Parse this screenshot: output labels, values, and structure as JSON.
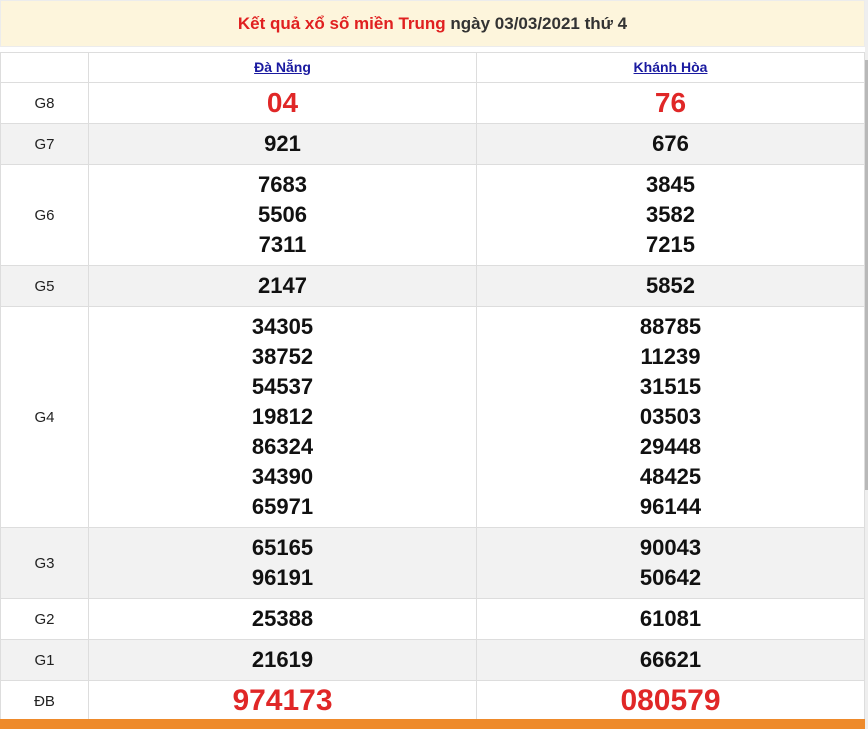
{
  "header": {
    "title_prefix": "Kết quả xổ số miền Trung",
    "title_suffix": " ngày 03/03/2021 thứ 4"
  },
  "provinces": [
    "Đà Nẵng",
    "Khánh Hòa"
  ],
  "prizes": [
    {
      "label": "G8",
      "col1": [
        "04"
      ],
      "col2": [
        "76"
      ]
    },
    {
      "label": "G7",
      "col1": [
        "921"
      ],
      "col2": [
        "676"
      ]
    },
    {
      "label": "G6",
      "col1": [
        "7683",
        "5506",
        "7311"
      ],
      "col2": [
        "3845",
        "3582",
        "7215"
      ]
    },
    {
      "label": "G5",
      "col1": [
        "2147"
      ],
      "col2": [
        "5852"
      ]
    },
    {
      "label": "G4",
      "col1": [
        "34305",
        "38752",
        "54537",
        "19812",
        "86324",
        "34390",
        "65971"
      ],
      "col2": [
        "88785",
        "11239",
        "31515",
        "03503",
        "29448",
        "48425",
        "96144"
      ]
    },
    {
      "label": "G3",
      "col1": [
        "65165",
        "96191"
      ],
      "col2": [
        "90043",
        "50642"
      ]
    },
    {
      "label": "G2",
      "col1": [
        "25388"
      ],
      "col2": [
        "61081"
      ]
    },
    {
      "label": "G1",
      "col1": [
        "21619"
      ],
      "col2": [
        "66621"
      ]
    },
    {
      "label": "ĐB",
      "col1": [
        "974173"
      ],
      "col2": [
        "080579"
      ]
    }
  ],
  "colors": {
    "accent_red": "#e02727",
    "header_bg": "#fdf5dc",
    "link_blue": "#1a1aa0",
    "bottom_bar": "#ee8a2b"
  }
}
